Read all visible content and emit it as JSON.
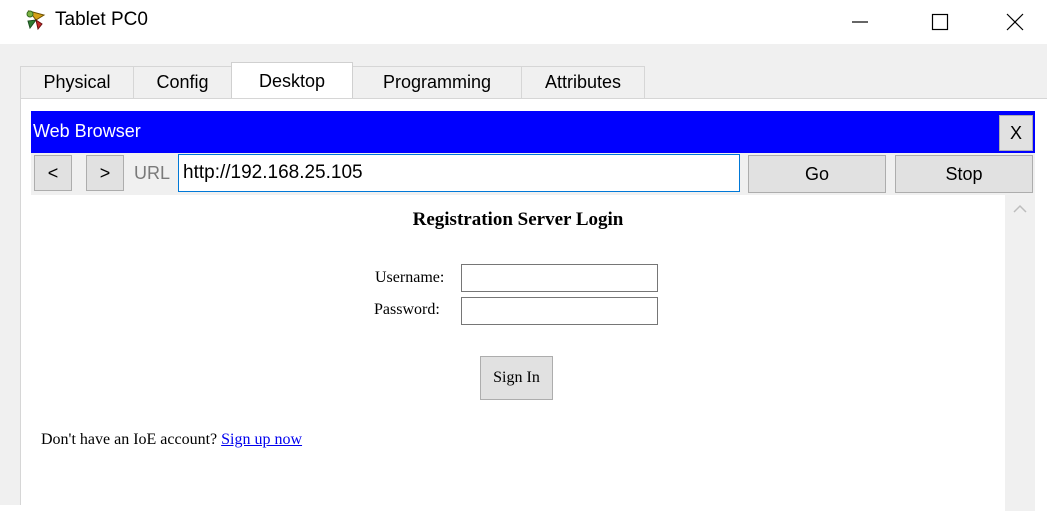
{
  "window": {
    "title": "Tablet PC0",
    "app_icon": "packet-tracer-device-icon",
    "controls": [
      "minimize-icon",
      "maximize-icon",
      "close-icon"
    ]
  },
  "tabs": [
    {
      "label": "Physical",
      "active": false
    },
    {
      "label": "Config",
      "active": false
    },
    {
      "label": "Desktop",
      "active": true
    },
    {
      "label": "Programming",
      "active": false
    },
    {
      "label": "Attributes",
      "active": false
    }
  ],
  "browser": {
    "title": "Web Browser",
    "close_label": "X",
    "back_label": "<",
    "forward_label": ">",
    "url_label": "URL",
    "url_value": "http://192.168.25.105",
    "go_label": "Go",
    "stop_label": "Stop",
    "header_color": "#0000ff"
  },
  "page": {
    "heading": "Registration Server Login",
    "username_label": "Username:",
    "password_label": "Password:",
    "username_value": "",
    "password_value": "",
    "signin_label": "Sign In",
    "footer_text": "Don't have an IoE account?",
    "signup_link": "Sign up now"
  }
}
